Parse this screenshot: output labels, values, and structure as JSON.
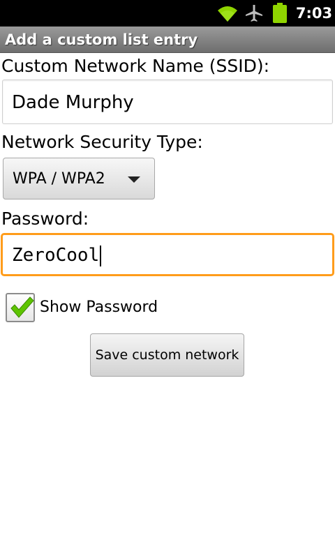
{
  "status_bar": {
    "time": "7:03",
    "icons": [
      "wifi-icon",
      "airplane-mode-icon",
      "battery-icon"
    ],
    "battery_color": "#8fd400",
    "wifi_color": "#8fd400"
  },
  "title_bar": {
    "title": "Add a custom list entry"
  },
  "form": {
    "ssid_label": "Custom Network Name (SSID):",
    "ssid_value": "Dade Murphy",
    "security_label": "Network Security Type:",
    "security_selected": "WPA / WPA2",
    "password_label": "Password:",
    "password_value": "ZeroCool",
    "show_password_label": "Show Password",
    "show_password_checked": true,
    "save_button_label": "Save custom network"
  },
  "colors": {
    "focus_border": "#ff9c1a",
    "checkmark": "#5ec400"
  }
}
